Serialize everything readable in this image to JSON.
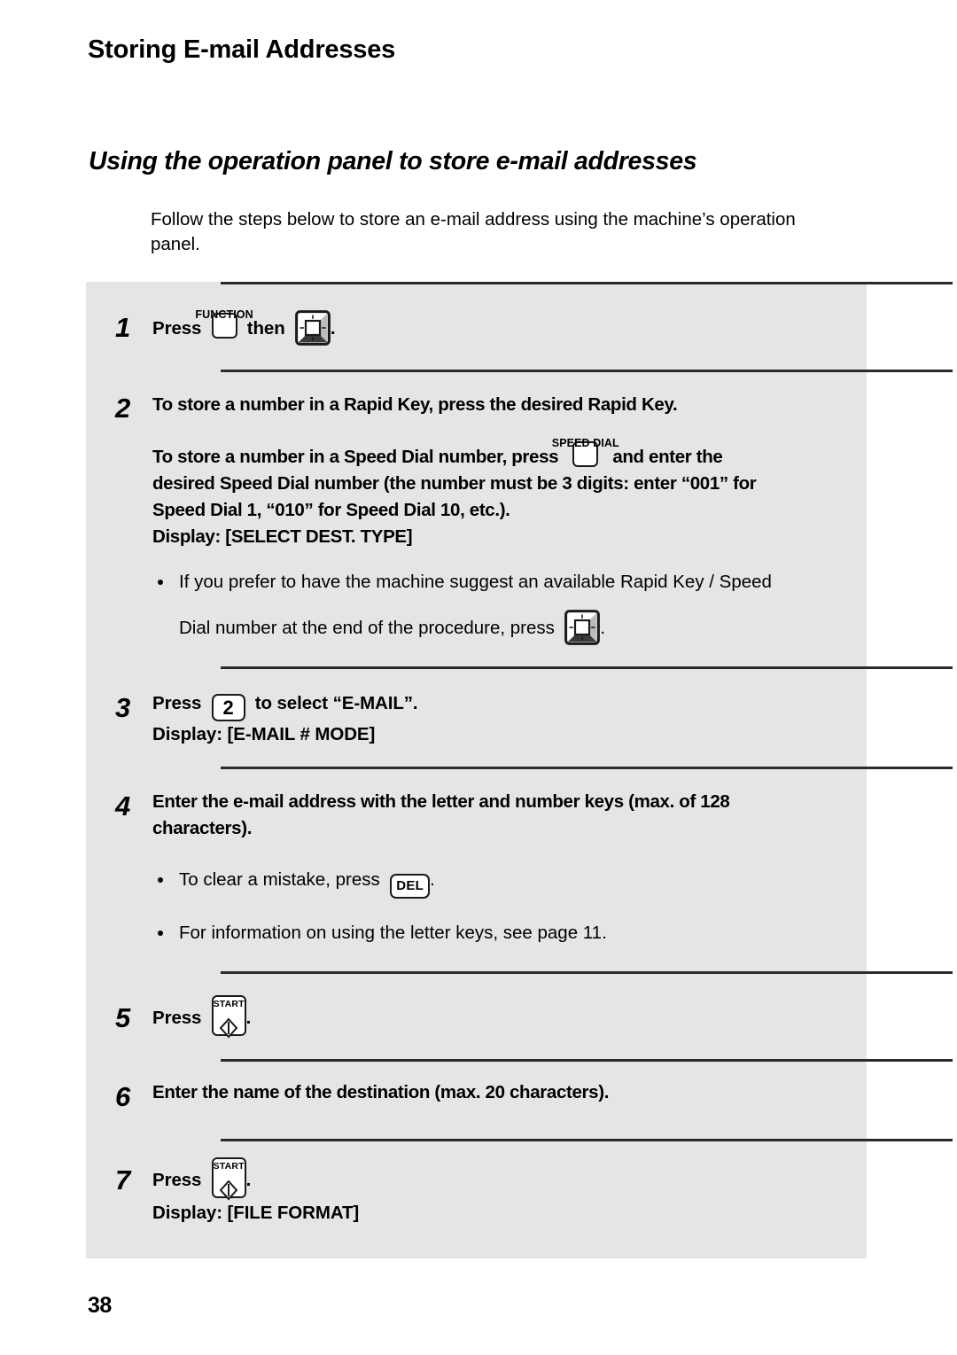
{
  "document": {
    "page_title": "Storing E-mail Addresses",
    "section_title": "Using the operation panel to store e-mail addresses",
    "intro": "Follow the steps below to store an e-mail address using the machine’s operation panel.",
    "page_number": "38"
  },
  "keys": {
    "function_caption": "FUNCTION",
    "speed_dial_caption": "SPEED DIAL",
    "start_caption": "START",
    "del_label": "DEL",
    "two_label": "2"
  },
  "steps": [
    {
      "number": "1",
      "press_label": "Press",
      "then_label": "then",
      "period": "."
    },
    {
      "number": "2",
      "line1": "To store a number in a Rapid Key, press the desired Rapid Key.",
      "line2_a": "To store a number in a Speed Dial number, press",
      "line2_b": "and enter the",
      "line3": "desired Speed Dial number (the number must be 3 digits: enter “001” for",
      "line4": "Speed Dial 1, “010” for Speed Dial 10, etc.).",
      "line5": "Display: [SELECT DEST. TYPE]",
      "bullet1_a": "If you prefer to have the machine suggest an available Rapid Key / Speed",
      "bullet1_b": "Dial number at the end of the procedure, press",
      "bullet1_c": "."
    },
    {
      "number": "3",
      "press_label": "Press",
      "after_key": "to select “E-MAIL”.",
      "display": "Display: [E-MAIL # MODE]"
    },
    {
      "number": "4",
      "line1": "Enter the e-mail address with the letter and number keys (max. of 128",
      "line2": "characters).",
      "bullet1_a": "To clear a mistake, press",
      "bullet1_b": ".",
      "bullet2": "For information on using the letter keys, see page 11."
    },
    {
      "number": "5",
      "press_label": "Press",
      "period": "."
    },
    {
      "number": "6",
      "line1": "Enter the name of the destination (max. 20 characters)."
    },
    {
      "number": "7",
      "press_label": "Press",
      "period": ".",
      "display": "Display: [FILE FORMAT]"
    }
  ],
  "colors": {
    "panel_background": "#e5e5e5",
    "separator": "#2b2b2b",
    "text": "#000000",
    "page_background": "#ffffff"
  }
}
